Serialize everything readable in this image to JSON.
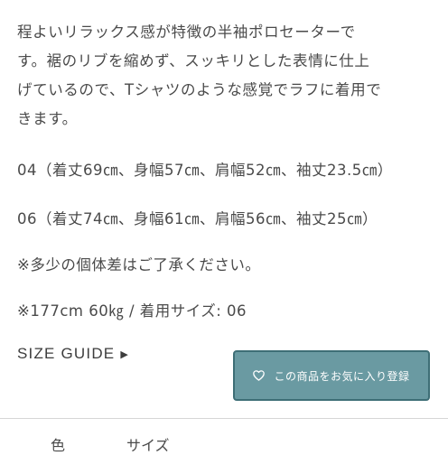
{
  "description": {
    "lines": [
      "程よいリラックス感が特徴の半袖ポロセーターで",
      "す。裾のリブを縮めず、スッキリとした表情に仕上",
      "げているので、Tシャツのような感覚でラフに着用で",
      "きます。"
    ]
  },
  "sizes": {
    "size_04": "04（着丈69㎝、身幅57㎝、肩幅52㎝、袖丈23.5㎝）",
    "size_06": "06（着丈74㎝、身幅61㎝、肩幅56㎝、袖丈25㎝）"
  },
  "note": "※多少の個体差はご了承ください。",
  "model": "※177cm 60㎏ / 着用サイズ: 06",
  "size_guide": {
    "label": "SIZE GUIDE",
    "arrow": "▶"
  },
  "favorite_button": {
    "label": "この商品をお気に入り登録",
    "icon": "heart-icon"
  },
  "table_header": {
    "color": "色",
    "size": "サイズ"
  },
  "colors": {
    "button_bg": "#6a9aa2",
    "button_border": "#3e6e76",
    "text": "#4a4a4a"
  }
}
